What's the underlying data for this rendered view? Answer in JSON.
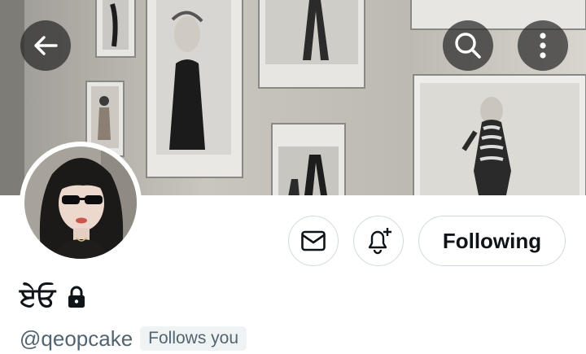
{
  "header": {
    "back_icon": "arrow-left-icon",
    "search_icon": "search-icon",
    "more_icon": "more-vertical-icon"
  },
  "profile": {
    "display_name": "ਏਓ",
    "handle": "@qeopcake",
    "follows_you": "Follows you",
    "locked_icon": "lock-icon"
  },
  "actions": {
    "message_icon": "mail-icon",
    "notify_icon": "bell-plus-icon",
    "follow_label": "Following"
  },
  "colors": {
    "text_primary": "#0f1419",
    "text_secondary": "#536471",
    "border": "#cfd9de",
    "badge_bg": "#eff3f4"
  }
}
